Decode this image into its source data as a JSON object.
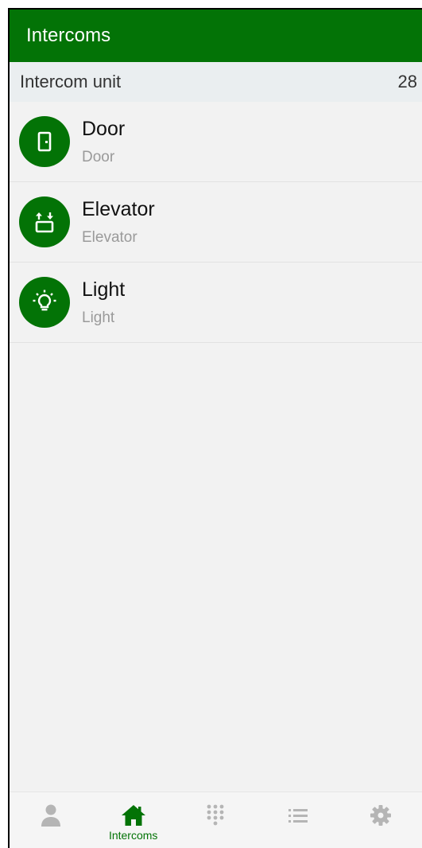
{
  "app_bar": {
    "title": "Intercoms"
  },
  "section": {
    "label": "Intercom unit",
    "count": "28"
  },
  "items": [
    {
      "title": "Door",
      "subtitle": "Door",
      "icon": "door-icon"
    },
    {
      "title": "Elevator",
      "subtitle": "Elevator",
      "icon": "elevator-icon"
    },
    {
      "title": "Light",
      "subtitle": "Light",
      "icon": "lightbulb-icon"
    }
  ],
  "bottom_nav": {
    "items": [
      {
        "icon": "person-icon",
        "label": ""
      },
      {
        "icon": "home-icon",
        "label": "Intercoms",
        "active": true
      },
      {
        "icon": "dialpad-icon",
        "label": ""
      },
      {
        "icon": "list-icon",
        "label": ""
      },
      {
        "icon": "gear-icon",
        "label": ""
      }
    ]
  },
  "colors": {
    "primary": "#037306",
    "inactive_icon": "#b5b5b5",
    "background": "#f2f2f2",
    "section_bg": "#eaeef0"
  }
}
